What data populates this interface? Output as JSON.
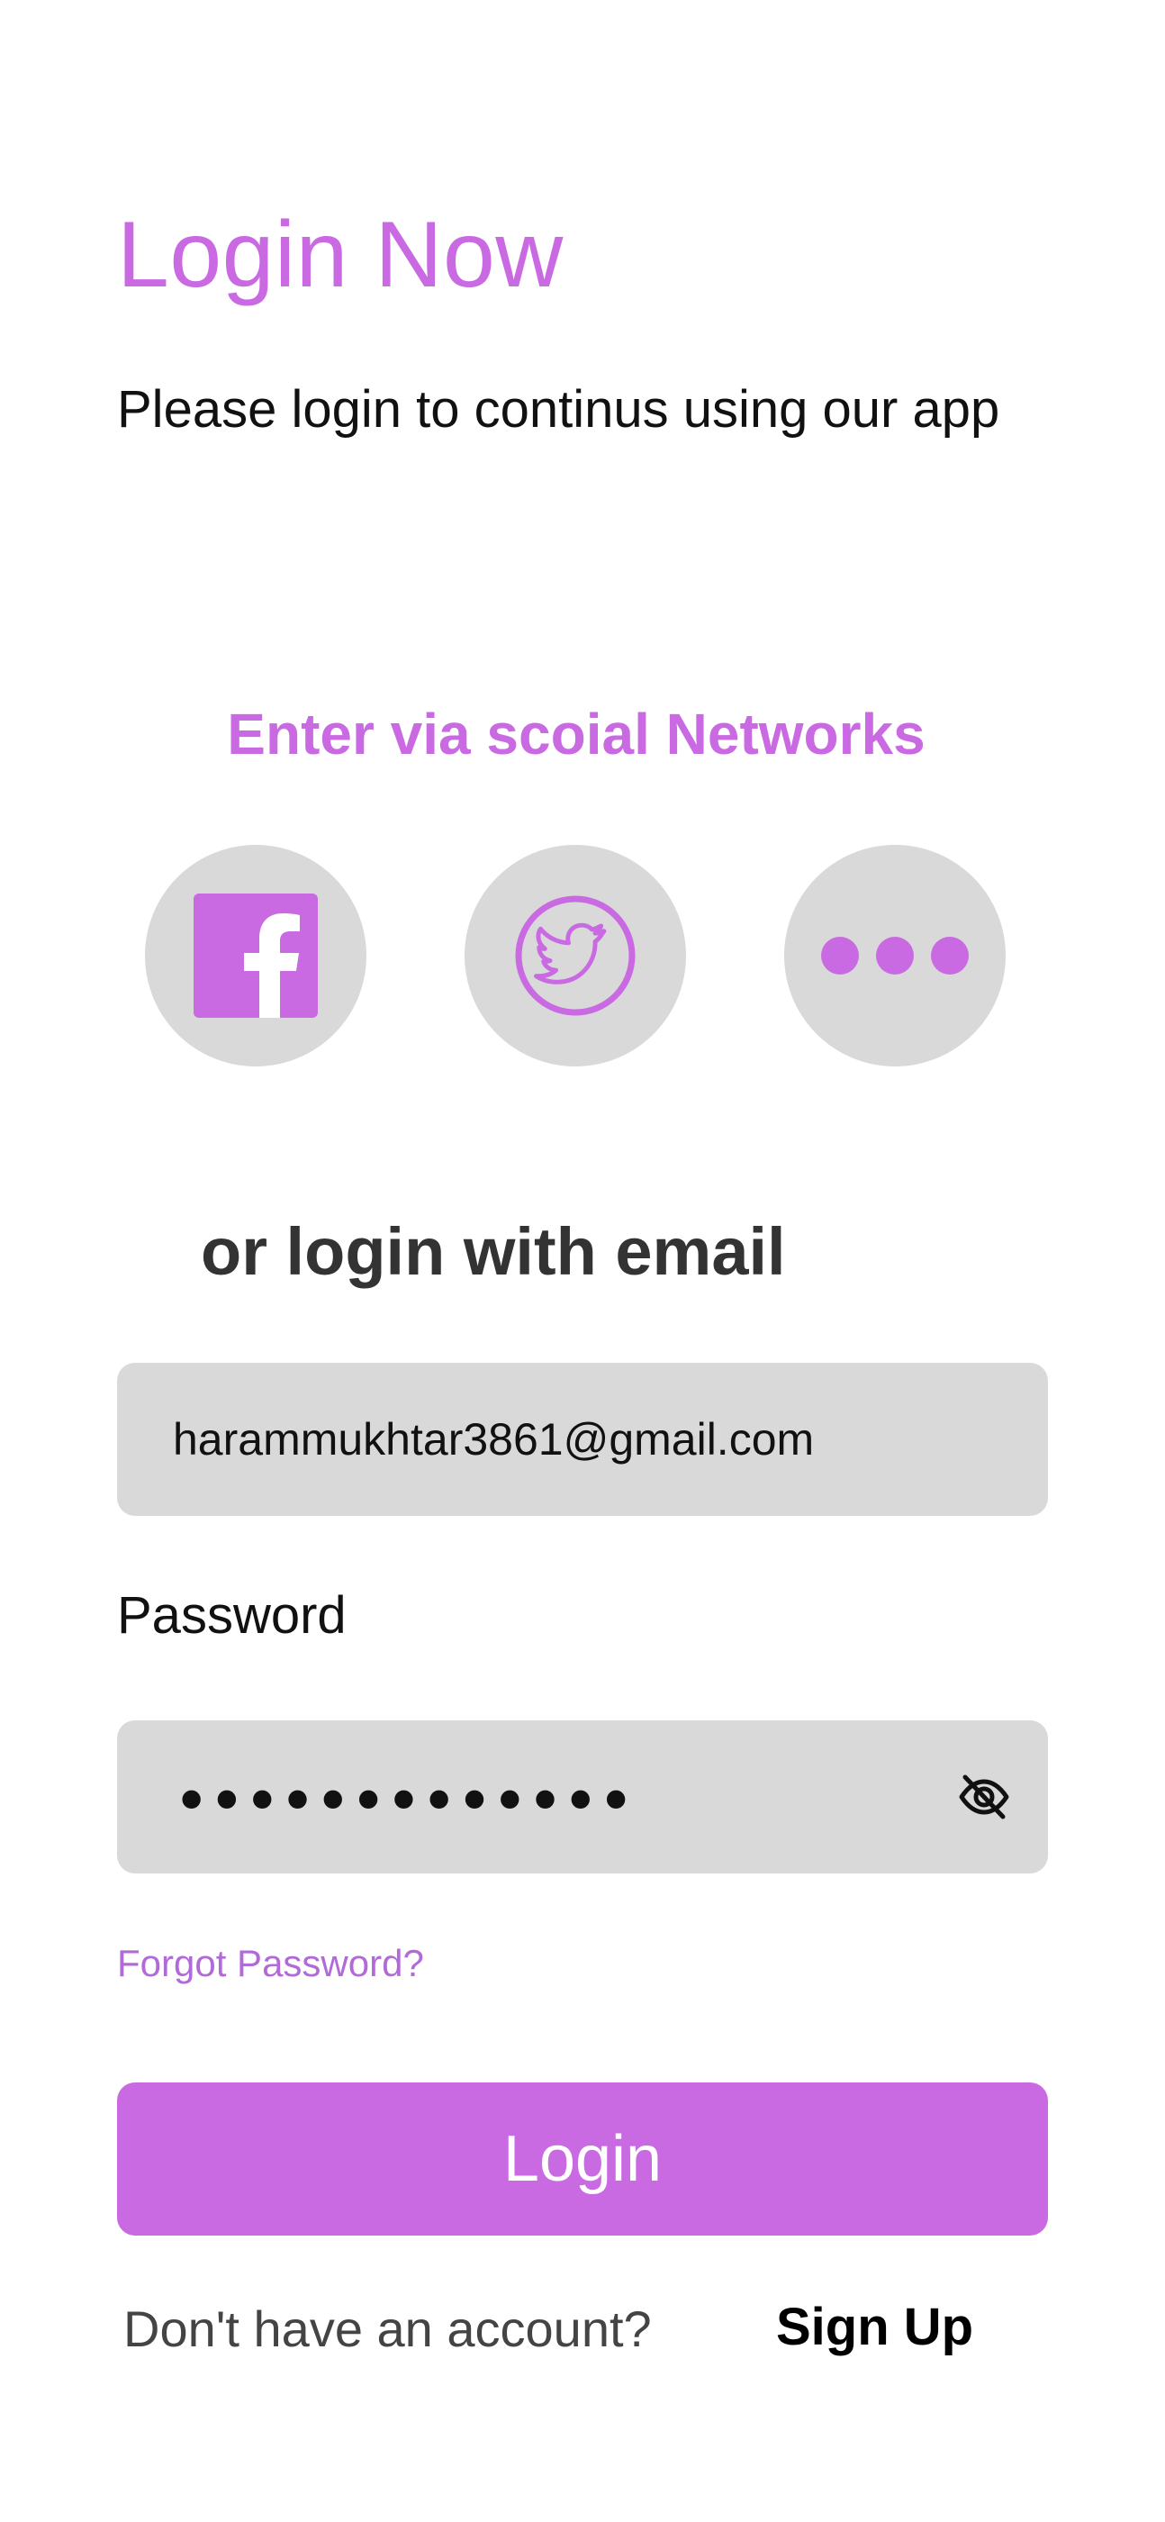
{
  "header": {
    "title": "Login Now",
    "subtitle": "Please login to continus using our app"
  },
  "social": {
    "heading": "Enter via scoial Networks",
    "buttons": [
      {
        "icon": "facebook-icon"
      },
      {
        "icon": "twitter-icon"
      },
      {
        "icon": "more-icon"
      }
    ]
  },
  "email_section": {
    "heading": "or login with email",
    "email_value": "harammukhtar3861@gmail.com"
  },
  "password_section": {
    "label": "Password",
    "masked_value": "•••••••••••••",
    "toggle_icon": "eye-off-icon"
  },
  "forgot_password": "Forgot Password?",
  "login_button": "Login",
  "footer": {
    "prompt": "Don't  have an account?",
    "signup_link": "Sign Up"
  },
  "colors": {
    "accent": "#c96ae3",
    "input_bg": "#d9d9d9",
    "heading_dark": "#333333"
  }
}
